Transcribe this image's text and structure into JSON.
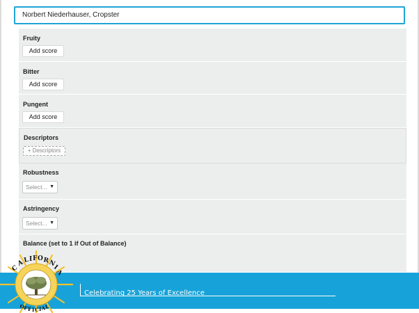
{
  "judge": {
    "value": "Norbert Niederhauser, Cropster"
  },
  "sections": {
    "fruity": {
      "title": "Fruity",
      "button": "Add score"
    },
    "bitter": {
      "title": "Bitter",
      "button": "Add score"
    },
    "pungent": {
      "title": "Pungent",
      "button": "Add score"
    },
    "descriptors": {
      "title": "Descriptors",
      "button": "+ Descriptors"
    },
    "robustness": {
      "title": "Robustness",
      "select": "Select...",
      "caret": "▼"
    },
    "astringency": {
      "title": "Astringency",
      "select": "Select...",
      "caret": "▼"
    },
    "balance": {
      "title": "Balance (set to 1 if Out of Balance)"
    }
  },
  "footer": {
    "tagline": "Celebrating 25 Years of Excellence"
  },
  "seal": {
    "top_text": "CALIFORNIA",
    "bottom_text": "OFFICIAL",
    "bottom_small": "COUNCIL",
    "icon": "olive-tree-icon"
  },
  "colors": {
    "accent": "#1ea5d8",
    "footer_bg": "#17a3d9",
    "panel_bg": "#eceeee",
    "seal_gold": "#f2c12e"
  }
}
